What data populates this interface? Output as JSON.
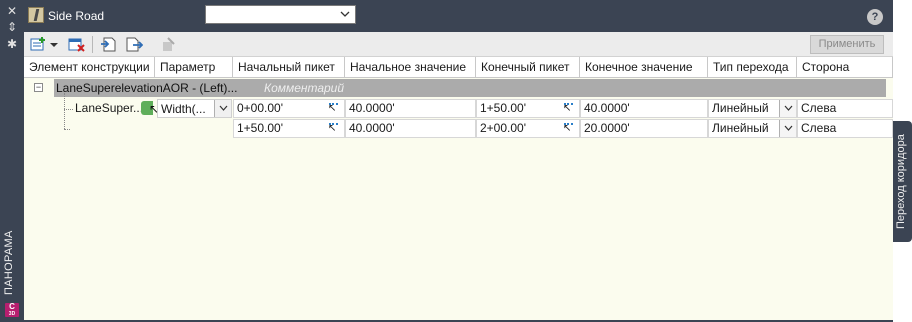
{
  "palette": {
    "side_title": "ПАНОРАМА",
    "logo": {
      "letter": "C",
      "sub": "3D"
    },
    "right_tab": "Переход коридора"
  },
  "header": {
    "road_name": "Side Road",
    "dropdown_value": "",
    "help_label": "?"
  },
  "toolbar": {
    "apply_label": "Применить"
  },
  "grid": {
    "columns": [
      "Элемент конструкции",
      "Параметр",
      "Начальный пикет",
      "Начальное значение",
      "Конечный пикет",
      "Конечное значение",
      "Тип перехода",
      "Сторона"
    ],
    "group": {
      "name": "LaneSuperelevationAOR - (Left)...",
      "comment": "Комментарий"
    },
    "child_name": "LaneSuper...",
    "param_value": "Width(...",
    "rows": [
      {
        "start_station": "0+00.00'",
        "start_value": "40.0000'",
        "end_station": "1+50.00'",
        "end_value": "40.0000'",
        "transition": "Линейный",
        "side": "Слева"
      },
      {
        "start_station": "1+50.00'",
        "start_value": "40.0000'",
        "end_station": "2+00.00'",
        "end_value": "20.0000'",
        "transition": "Линейный",
        "side": "Слева"
      }
    ]
  }
}
